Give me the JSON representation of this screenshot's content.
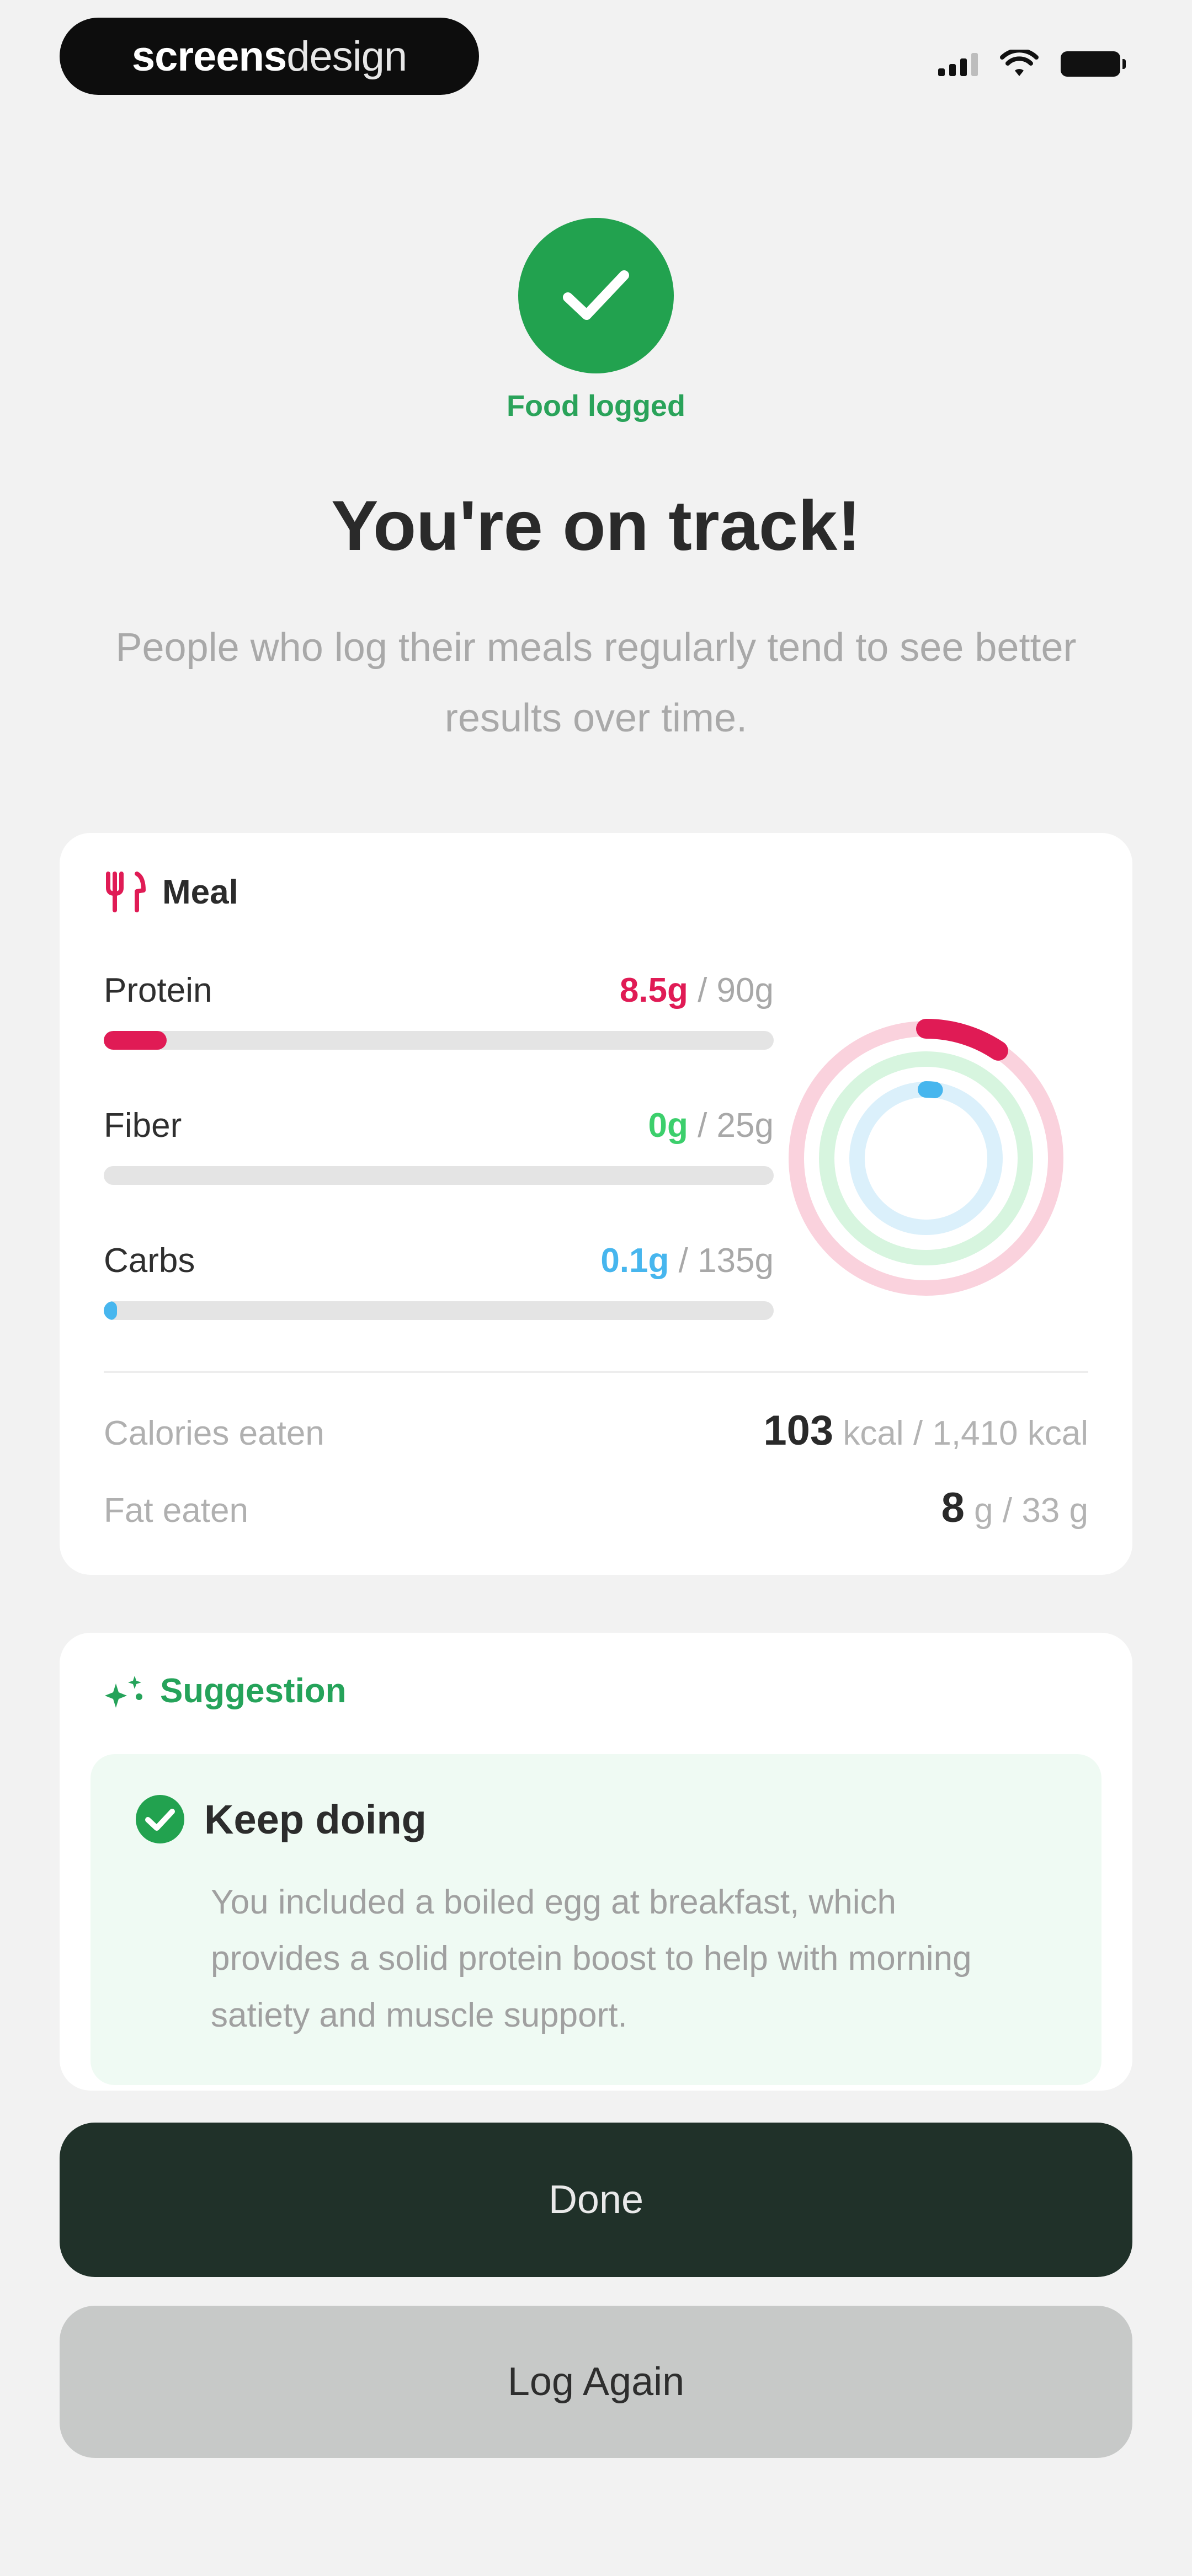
{
  "status_bar": {
    "brand_strong": "screens",
    "brand_light": "design"
  },
  "header": {
    "badge_label": "Food logged",
    "title": "You're on track!",
    "subtitle": "People who log their meals regularly tend to see better results over time."
  },
  "meal": {
    "title": "Meal",
    "macros": [
      {
        "name": "Protein",
        "value": "8.5g",
        "target": " / 90g",
        "progress": 0.094,
        "color": "#e01b55"
      },
      {
        "name": "Fiber",
        "value": "0g",
        "target": " / 25g",
        "progress": 0.0,
        "color": "#3ccf6c"
      },
      {
        "name": "Carbs",
        "value": "0.1g",
        "target": " / 135g",
        "progress": 0.001,
        "color": "#47b6ee"
      }
    ],
    "stats": [
      {
        "label": "Calories eaten",
        "value": "103",
        "target": " kcal / 1,410 kcal"
      },
      {
        "label": "Fat eaten",
        "value": "8",
        "target": " g / 33 g"
      }
    ]
  },
  "suggestion": {
    "title": "Suggestion",
    "tip_title": "Keep doing",
    "tip_text": "You included a boiled egg at breakfast, which provides a solid protein boost to help with morning satiety and muscle support."
  },
  "actions": {
    "done_label": "Done",
    "log_again_label": "Log Again"
  },
  "colors": {
    "accent_green": "#22a24f",
    "primary_button": "#203129",
    "secondary_button": "#c7c9c8"
  }
}
